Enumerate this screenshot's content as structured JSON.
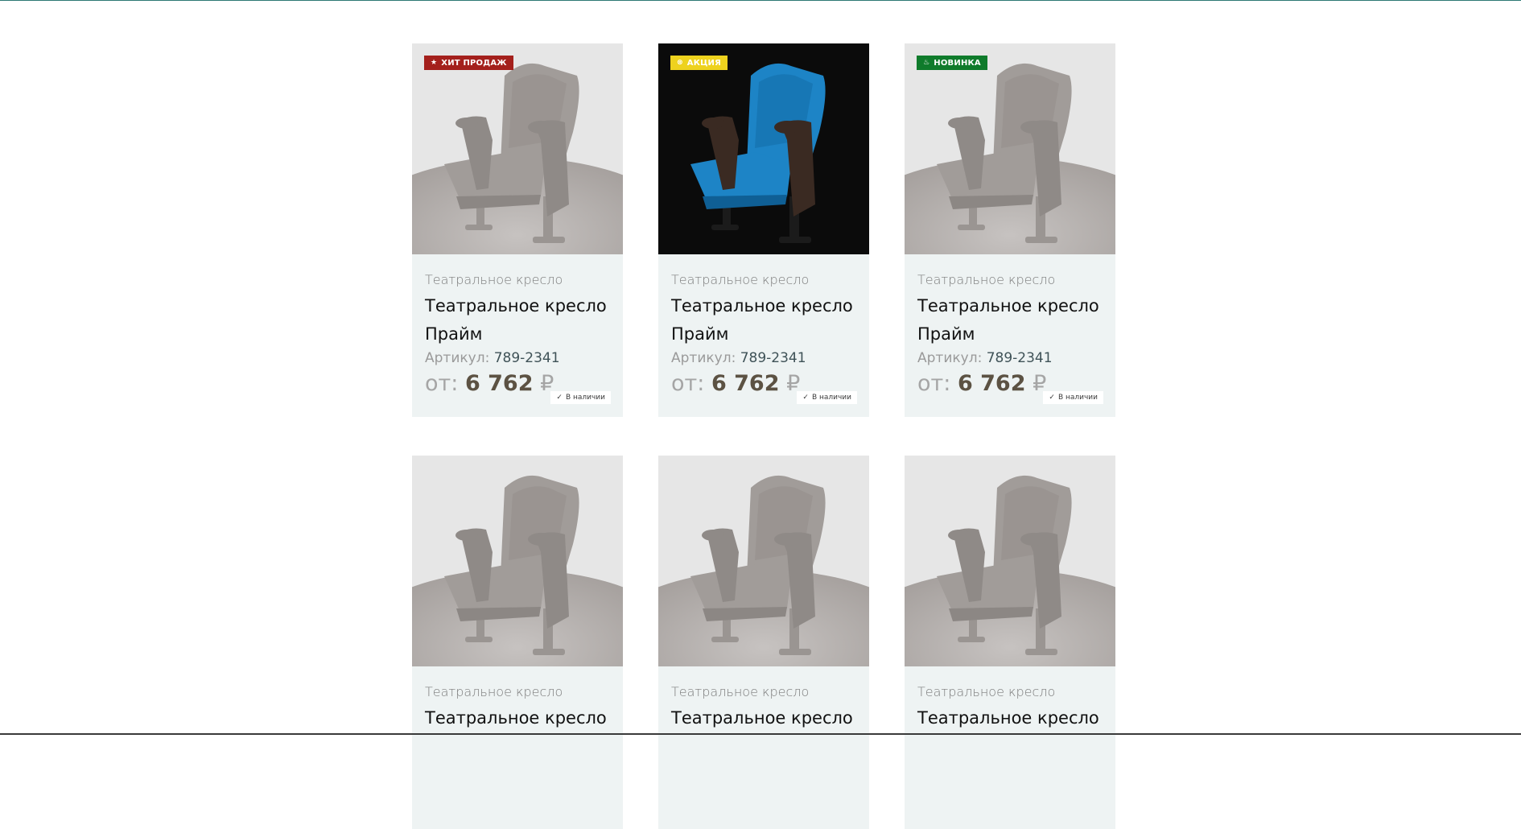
{
  "colors": {
    "hit_badge": "#a4201c",
    "sale_badge": "#eed21e",
    "new_badge": "#0f7b2b",
    "card_background": "#eef3f3",
    "price_accent": "#5c5243"
  },
  "cards": [
    {
      "badge": {
        "label": "ХИТ ПРОДАЖ",
        "icon": "star-icon",
        "glyph": "★",
        "color": "#a4201c"
      },
      "stock": {
        "label": "В наличии",
        "glyph": "✓"
      },
      "category": "Театральное кресло",
      "title": "Театральное кресло Прайм",
      "sku_label": "Артикул: ",
      "sku": "789-2341",
      "price_prefix": "от: ",
      "price": "6 762",
      "currency": " ₽",
      "image": "chair-grey"
    },
    {
      "badge": {
        "label": "АКЦИЯ",
        "icon": "percent-icon",
        "glyph": "⊗",
        "color": "#eed21e"
      },
      "stock": {
        "label": "В наличии",
        "glyph": "✓"
      },
      "category": "Театральное кресло",
      "title": "Театральное кресло Прайм",
      "sku_label": "Артикул: ",
      "sku": "789-2341",
      "price_prefix": "от: ",
      "price": "6 762",
      "currency": " ₽",
      "image": "chair-blue"
    },
    {
      "badge": {
        "label": "НОВИНКА",
        "icon": "flame-icon",
        "glyph": "♨",
        "color": "#0f7b2b"
      },
      "stock": {
        "label": "В наличии",
        "glyph": "✓"
      },
      "category": "Театральное кресло",
      "title": "Театральное кресло Прайм",
      "sku_label": "Артикул: ",
      "sku": "789-2341",
      "price_prefix": "от: ",
      "price": "6 762",
      "currency": " ₽",
      "image": "chair-grey"
    },
    {
      "category": "Театральное кресло",
      "title": "Театральное кресло",
      "image": "chair-grey"
    },
    {
      "category": "Театральное кресло",
      "title": "Театральное кресло",
      "image": "chair-grey"
    },
    {
      "category": "Театральное кресло",
      "title": "Театральное кресло",
      "image": "chair-grey"
    }
  ]
}
